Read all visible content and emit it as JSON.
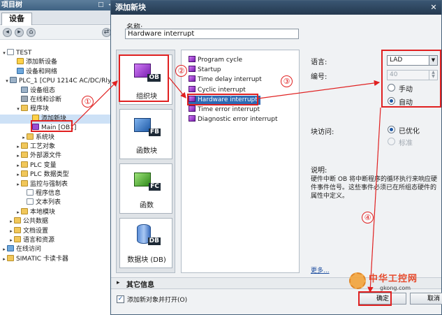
{
  "tree": {
    "header": "项目树",
    "header_icons": "□ ◂",
    "device_tab": "设备",
    "toolbar_icons": [
      "◂",
      "▸",
      "⌂",
      "⇄"
    ],
    "items": [
      {
        "label": "TEST",
        "toggle": "▾",
        "icon": "doc"
      },
      {
        "label": "添加新设备",
        "toggle": "",
        "icon": "add"
      },
      {
        "label": "设备和网络",
        "toggle": "",
        "icon": "net"
      },
      {
        "label": "PLC_1 [CPU 1214C AC/DC/Rly]",
        "toggle": "▾",
        "icon": "plc"
      },
      {
        "label": "设备组态",
        "toggle": "",
        "icon": "plc"
      },
      {
        "label": "在线和诊断",
        "toggle": "",
        "icon": "gear"
      },
      {
        "label": "程序块",
        "toggle": "▾",
        "icon": "folder"
      },
      {
        "label": "添加新块",
        "toggle": "",
        "icon": "add"
      },
      {
        "label": "Main [OB1]",
        "toggle": "",
        "icon": "ob"
      },
      {
        "label": "系统块",
        "toggle": "▸",
        "icon": "folder"
      },
      {
        "label": "工艺对象",
        "toggle": "▸",
        "icon": "folder"
      },
      {
        "label": "外部源文件",
        "toggle": "▸",
        "icon": "folder"
      },
      {
        "label": "PLC 变量",
        "toggle": "▸",
        "icon": "folder"
      },
      {
        "label": "PLC 数据类型",
        "toggle": "▸",
        "icon": "folder"
      },
      {
        "label": "监控与强制表",
        "toggle": "▸",
        "icon": "folder"
      },
      {
        "label": "程序信息",
        "toggle": "",
        "icon": "doc"
      },
      {
        "label": "文本列表",
        "toggle": "",
        "icon": "doc"
      },
      {
        "label": "本地模块",
        "toggle": "▸",
        "icon": "folder"
      },
      {
        "label": "公共数据",
        "toggle": "▸",
        "icon": "folder"
      },
      {
        "label": "文档设置",
        "toggle": "▸",
        "icon": "folder"
      },
      {
        "label": "语言和资源",
        "toggle": "▸",
        "icon": "folder"
      },
      {
        "label": "在线访问",
        "toggle": "▸",
        "icon": "net"
      },
      {
        "label": "SIMATIC 卡读卡器",
        "toggle": "▸",
        "icon": "folder"
      }
    ]
  },
  "dialog": {
    "title": "添加新块",
    "close": "✕",
    "name_label": "名称:",
    "name_value": "Hardware interrupt",
    "block_types": [
      {
        "tag": "OB",
        "label": "组织块",
        "kind": "ob"
      },
      {
        "tag": "FB",
        "label": "函数块",
        "kind": "fb"
      },
      {
        "tag": "FC",
        "label": "函数",
        "kind": "fc"
      },
      {
        "tag": "DB",
        "label": "数据块 (DB)",
        "kind": "db"
      }
    ],
    "events": [
      "Program cycle",
      "Startup",
      "Time delay interrupt",
      "Cyclic interrupt",
      "Hardware interrupt",
      "Time error interrupt",
      "Diagnostic error interrupt"
    ],
    "selected_event": "Hardware interrupt",
    "language_label": "语言:",
    "language_value": "LAD",
    "number_label": "编号:",
    "number_value": "40",
    "manual_label": "手动",
    "auto_label": "自动",
    "block_access_label": "块访问:",
    "optimized_label": "已优化",
    "standard_label": "标准",
    "description_label": "说明:",
    "description_text": "硬件中断 OB 将中断程序的循环执行来响应硬件事件信号。这些事件必须已在所组态硬件的属性中定义。",
    "more_link": "更多...",
    "more_info": "其它信息",
    "more_info_arrow": "▸",
    "open_checkbox_label": "添加新对象并打开(O)",
    "open_checkbox_mark": "✓",
    "ok_label": "确定",
    "cancel_label": "取消"
  },
  "annotations": {
    "markers": [
      "①",
      "②",
      "③",
      "④"
    ],
    "color": "#e02020"
  },
  "watermark": {
    "title": "中华工控网",
    "url": "gkong.com"
  },
  "colors": {
    "titlebar": "#24394f",
    "selection": "#2e6ab4",
    "ob_purple": "#7a1fb0"
  }
}
